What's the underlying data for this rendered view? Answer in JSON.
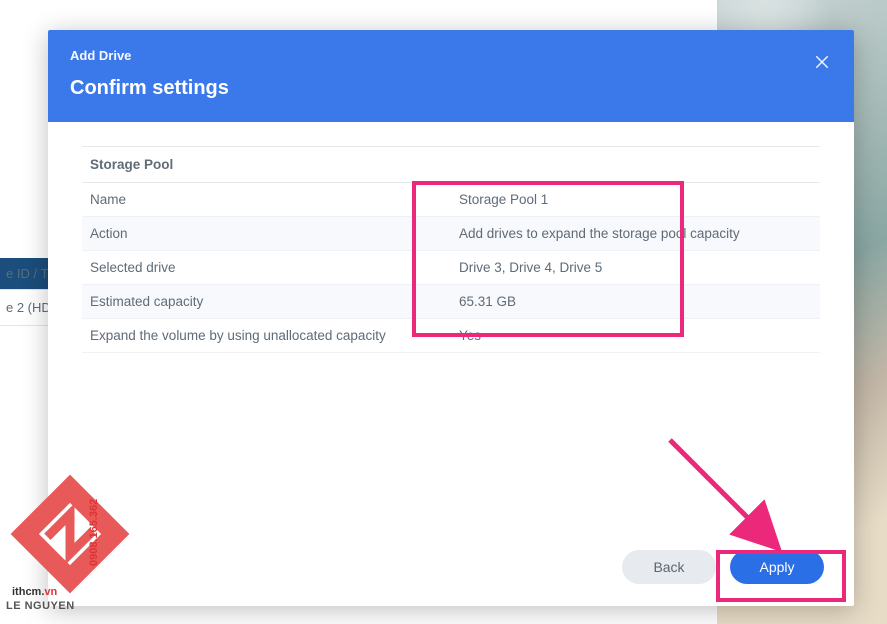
{
  "behind": {
    "header_label": "e ID / T",
    "item_label": "e 2 (HD"
  },
  "dialog": {
    "window_title": "Add Drive",
    "page_title": "Confirm settings",
    "section_header": "Storage Pool",
    "rows": {
      "name": {
        "key": "Name",
        "val": "Storage Pool 1"
      },
      "action": {
        "key": "Action",
        "val": "Add drives to expand the storage pool capacity"
      },
      "selected_drive": {
        "key": "Selected drive",
        "val": "Drive 3, Drive 4, Drive 5"
      },
      "est_capacity": {
        "key": "Estimated capacity",
        "val": "65.31 GB"
      },
      "expand_unalloc": {
        "key": "Expand the volume by using unallocated capacity",
        "val": "Yes"
      }
    },
    "buttons": {
      "back": "Back",
      "apply": "Apply"
    }
  },
  "watermark": {
    "label": "LE NGUYEN",
    "domain_main": "ithcm.",
    "domain_tld": "vn",
    "phone": "0908.165.362"
  }
}
